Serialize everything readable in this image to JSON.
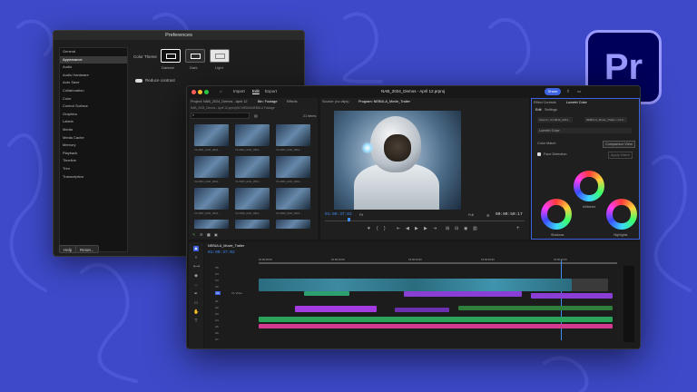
{
  "brand": {
    "logo_text": "Pr",
    "color_bg": "#00005b",
    "color_fg": "#9999ff"
  },
  "prefs": {
    "title": "Preferences",
    "items": [
      "General",
      "Appearance",
      "Audio",
      "Audio Hardware",
      "Auto Save",
      "Collaboration",
      "Color",
      "Control Surface",
      "Graphics",
      "Labels",
      "Media",
      "Media Cache",
      "Memory",
      "Playback",
      "Timeline",
      "Trim",
      "Transcription"
    ],
    "active_item": "Appearance",
    "color_theme_label": "Color Theme",
    "themes": [
      "Darkest",
      "Dark",
      "Light"
    ],
    "reduce_contrast_label": "Reduce contrast",
    "help_label": "Help",
    "reset_label": "Reset..."
  },
  "main": {
    "nav": [
      "Import",
      "Edit",
      "Export"
    ],
    "title": "NAB_2024_Demos - April 12.prproj",
    "share_label": "Share",
    "project_tab": "Project: NAB_2024_Demos - April 12",
    "bin_tab": "Bin: Footage",
    "effects_tab": "Effects",
    "breadcrumb": "NAB_2024_Demos - April 12.prproj\\NO MEDIA\\NEBULA Footage",
    "item_count": "21 items",
    "source_tab": "Source: (no clips)",
    "program_tab": "Program: NEBULA_Movie_Trailer",
    "program_tc": "01:00:37:02",
    "fit_label": "Fit",
    "full_label": "Full",
    "duration_tc": "00:00:50:17",
    "effect_controls_tab": "Effect Controls",
    "lumetri_tab": "Lumetri Color",
    "edit_label": "Edit",
    "settings_label": "Settings",
    "source_select": "Source • V1-0013_A011...",
    "sequence_select": "NEBULA_Movie_Trailer • V1-0...",
    "lumetri_label": "Lumetri Color",
    "color_match_label": "Color Match",
    "comparison_view_label": "Comparison View",
    "face_detection_label": "Face Detection",
    "apply_match_label": "Apply Match",
    "wheels": [
      "Midtones",
      "Shadows",
      "Highlights"
    ],
    "sequence_tab": "NEBULA_Movie_Trailer",
    "sequence_tc": "01:00:37:02",
    "ruler_times": [
      "01:00:00:00",
      "01:00:10:00",
      "01:00:20:00",
      "01:00:30:00",
      "01:00:40:00"
    ],
    "track_labels": [
      "V5",
      "V4",
      "V3",
      "V2",
      "V1",
      "A1",
      "A2",
      "A3",
      "A4",
      "A5",
      "A6",
      "A7"
    ],
    "v1_label": "V1 Video",
    "thumb_labels": [
      "V1-0001_A011_0612...",
      "V1-0002_A011_0612...",
      "V1-0003_A011_0612...",
      "V1-0004_A011_0612...",
      "V1-0005_A011_0612...",
      "V1-0006_A011_0612...",
      "V1-0007_A011_0612...",
      "V1-0008_A011_0612...",
      "V1-0009_A011_0612..."
    ],
    "thumb_durations": [
      "7:11",
      "2:08",
      "3:06",
      "3:04",
      "2:11",
      "2:07",
      "3:01",
      "1:04",
      "3:09"
    ]
  }
}
